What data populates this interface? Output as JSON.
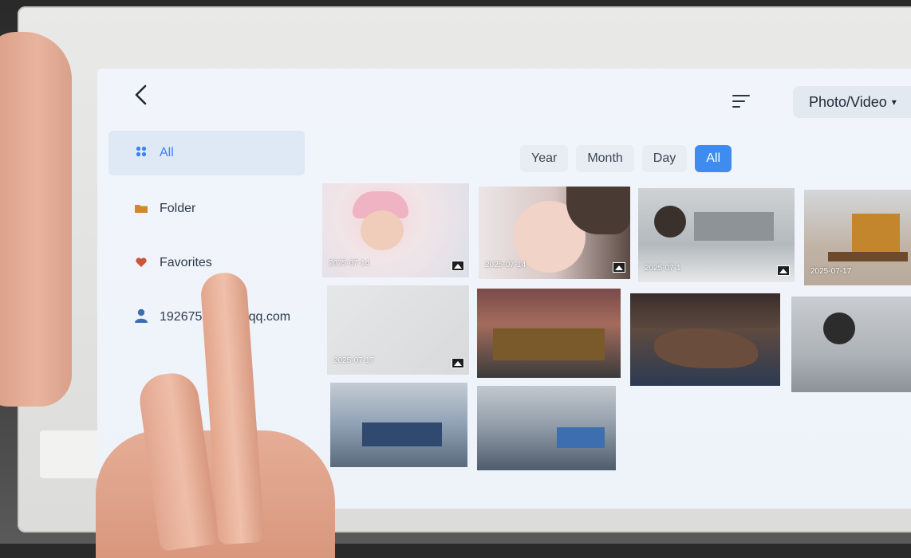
{
  "topbar": {
    "back_icon": "chevron-left-icon",
    "sort_icon": "sort-lines-icon",
    "media_type_label": "Photo/Video",
    "media_type_caret": "▾"
  },
  "sidebar": {
    "items": [
      {
        "label": "All",
        "icon": "grid-icon",
        "active": true
      },
      {
        "label": "Folder",
        "icon": "folder-icon"
      },
      {
        "label": "Favorites",
        "icon": "heart-icon"
      },
      {
        "label": "192675",
        "icon": "user-icon"
      }
    ],
    "account_suffix": "@qq.com"
  },
  "filters": {
    "options": [
      "Year",
      "Month",
      "Day",
      "All"
    ],
    "selected": "All"
  },
  "photos": [
    {
      "date": "2025-07-14"
    },
    {
      "date": "2025-07-14"
    },
    {
      "date": "2025-07-1"
    },
    {
      "date": "2025-07-17"
    },
    {
      "date": "2025-07-17"
    },
    {
      "date": ""
    },
    {
      "date": ""
    },
    {
      "date": ""
    },
    {
      "date": ""
    },
    {
      "date": ""
    }
  ],
  "colors": {
    "accent": "#3f8cf0",
    "sidebar_active_bg": "#dfe8f5",
    "screen_bg": "#f1f5fb"
  }
}
